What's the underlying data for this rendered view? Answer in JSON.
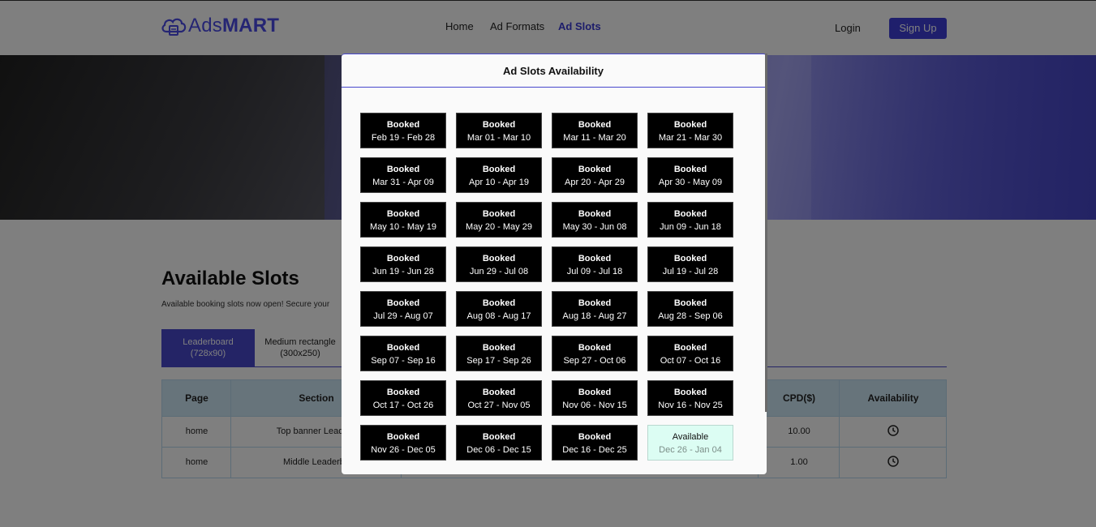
{
  "brand": {
    "name_part1": "Ads",
    "name_part2": "MART",
    "accent": "#4a4ae6"
  },
  "nav": {
    "home": "Home",
    "ad_formats": "Ad Formats",
    "ad_slots": "Ad Slots"
  },
  "auth": {
    "login": "Login",
    "signup": "Sign Up"
  },
  "section": {
    "title": "Available Slots",
    "subtitle": "Available booking slots now open! Secure your"
  },
  "tabs": [
    {
      "label_line1": "Leaderboard",
      "label_line2": "(728x90)"
    },
    {
      "label_line1": "Medium rectangle",
      "label_line2": "(300x250)"
    }
  ],
  "table": {
    "headers": {
      "page": "Page",
      "section": "Section",
      "cpd": "CPD($)",
      "availability": "Availability"
    },
    "rows": [
      {
        "page": "home",
        "section": "Top banner Leaderb",
        "cpd": "10.00",
        "availability_icon": "clock-icon"
      },
      {
        "page": "home",
        "section": "Middle Leaderbo",
        "cpd": "1.00",
        "availability_icon": "clock-icon"
      }
    ]
  },
  "modal": {
    "title": "Ad Slots Availability",
    "slots": [
      {
        "status": "Booked",
        "range": "Feb 19 - Feb 28"
      },
      {
        "status": "Booked",
        "range": "Mar 01 - Mar 10"
      },
      {
        "status": "Booked",
        "range": "Mar 11 - Mar 20"
      },
      {
        "status": "Booked",
        "range": "Mar 21 - Mar 30"
      },
      {
        "status": "Booked",
        "range": "Mar 31 - Apr 09"
      },
      {
        "status": "Booked",
        "range": "Apr 10 - Apr 19"
      },
      {
        "status": "Booked",
        "range": "Apr 20 - Apr 29"
      },
      {
        "status": "Booked",
        "range": "Apr 30 - May 09"
      },
      {
        "status": "Booked",
        "range": "May 10 - May 19"
      },
      {
        "status": "Booked",
        "range": "May 20 - May 29"
      },
      {
        "status": "Booked",
        "range": "May 30 - Jun 08"
      },
      {
        "status": "Booked",
        "range": "Jun 09 - Jun 18"
      },
      {
        "status": "Booked",
        "range": "Jun 19 - Jun 28"
      },
      {
        "status": "Booked",
        "range": "Jun 29 - Jul 08"
      },
      {
        "status": "Booked",
        "range": "Jul 09 - Jul 18"
      },
      {
        "status": "Booked",
        "range": "Jul 19 - Jul 28"
      },
      {
        "status": "Booked",
        "range": "Jul 29 - Aug 07"
      },
      {
        "status": "Booked",
        "range": "Aug 08 - Aug 17"
      },
      {
        "status": "Booked",
        "range": "Aug 18 - Aug 27"
      },
      {
        "status": "Booked",
        "range": "Aug 28 - Sep 06"
      },
      {
        "status": "Booked",
        "range": "Sep 07 - Sep 16"
      },
      {
        "status": "Booked",
        "range": "Sep 17 - Sep 26"
      },
      {
        "status": "Booked",
        "range": "Sep 27 - Oct 06"
      },
      {
        "status": "Booked",
        "range": "Oct 07 - Oct 16"
      },
      {
        "status": "Booked",
        "range": "Oct 17 - Oct 26"
      },
      {
        "status": "Booked",
        "range": "Oct 27 - Nov 05"
      },
      {
        "status": "Booked",
        "range": "Nov 06 - Nov 15"
      },
      {
        "status": "Booked",
        "range": "Nov 16 - Nov 25"
      },
      {
        "status": "Booked",
        "range": "Nov 26 - Dec 05"
      },
      {
        "status": "Booked",
        "range": "Dec 06 - Dec 15"
      },
      {
        "status": "Booked",
        "range": "Dec 16 - Dec 25"
      },
      {
        "status": "Available",
        "range": "Dec 26 - Jan 04"
      }
    ]
  }
}
